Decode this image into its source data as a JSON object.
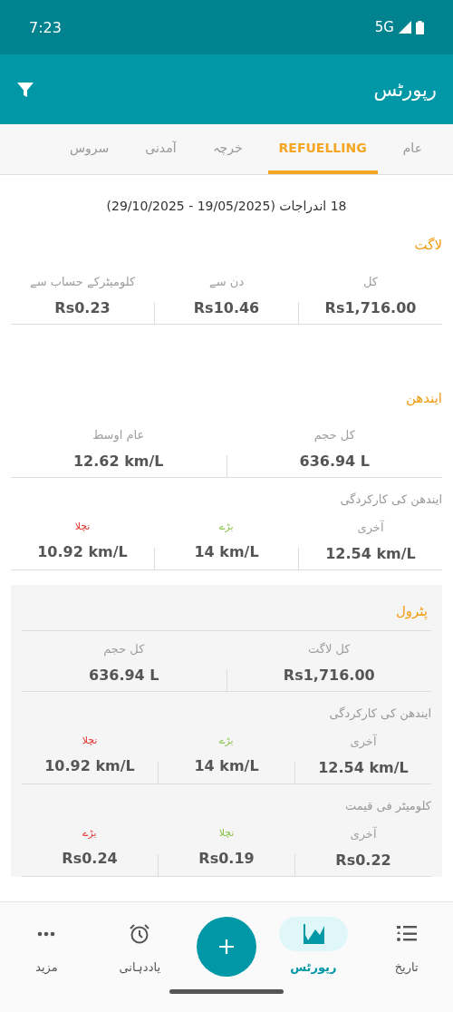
{
  "status_bar": {
    "time": "7:23",
    "network": "5G"
  },
  "app_bar": {
    "title": "رپورٹس"
  },
  "tabs": [
    {
      "label": "عام",
      "selected": false
    },
    {
      "label": "REFUELLING",
      "selected": true
    },
    {
      "label": "خرچہ",
      "selected": false
    },
    {
      "label": "آمدنی",
      "selected": false
    },
    {
      "label": "سروس",
      "selected": false
    }
  ],
  "summary": "18 اندراجات (19/05/2025 - 29/10/2025)",
  "sections": [
    {
      "title": "لاگت",
      "card": false,
      "groups": [
        {
          "cells": [
            {
              "label": "کل",
              "value": "Rs1,716.00",
              "color": "#9e9e9e"
            },
            {
              "label": "دن سے",
              "value": "Rs10.46",
              "color": "#9e9e9e"
            },
            {
              "label": "کلومیٹرکے حساب سے",
              "value": "Rs0.23",
              "color": "#9e9e9e"
            }
          ]
        }
      ]
    },
    {
      "title": "ایندھن",
      "card": false,
      "groups": [
        {
          "cells": [
            {
              "label": "کل حجم",
              "value": "636.94 L",
              "color": "#9e9e9e"
            },
            {
              "label": "عام اوسط",
              "value": "12.62 km/L",
              "color": "#9e9e9e"
            }
          ]
        },
        {
          "heading": "ایندھن کی کارکردگی",
          "cells": [
            {
              "label": "آخری",
              "value": "12.54 km/L",
              "color": "#9e9e9e"
            },
            {
              "label": "بڑے",
              "value": "14 km/L",
              "color": "#8bc34a"
            },
            {
              "label": "نچلا",
              "value": "10.92 km/L",
              "color": "#e53935"
            }
          ]
        }
      ]
    },
    {
      "title": "پٹرول",
      "card": true,
      "groups": [
        {
          "cells": [
            {
              "label": "کل لاگت",
              "value": "Rs1,716.00",
              "color": "#9e9e9e"
            },
            {
              "label": "کل حجم",
              "value": "636.94 L",
              "color": "#9e9e9e"
            }
          ]
        },
        {
          "heading": "ایندھن کی کارکردگی",
          "cells": [
            {
              "label": "آخری",
              "value": "12.54 km/L",
              "color": "#9e9e9e"
            },
            {
              "label": "بڑے",
              "value": "14 km/L",
              "color": "#8bc34a"
            },
            {
              "label": "نچلا",
              "value": "10.92 km/L",
              "color": "#e53935"
            }
          ]
        },
        {
          "heading": "کلومیٹر فی قیمت",
          "cells": [
            {
              "label": "آخری",
              "value": "Rs0.22",
              "color": "#9e9e9e"
            },
            {
              "label": "نچلا",
              "value": "Rs0.19",
              "color": "#8bc34a"
            },
            {
              "label": "بڑے",
              "value": "Rs0.24",
              "color": "#e53935"
            }
          ]
        }
      ]
    }
  ],
  "bottom_nav": [
    {
      "kind": "history",
      "label": "تاریخ",
      "selected": false
    },
    {
      "kind": "reports",
      "label": "رپورٹس",
      "selected": true
    },
    {
      "kind": "add"
    },
    {
      "kind": "reminders",
      "label": "یاددہانی",
      "selected": false
    },
    {
      "kind": "more",
      "label": "مزید",
      "selected": false
    }
  ]
}
